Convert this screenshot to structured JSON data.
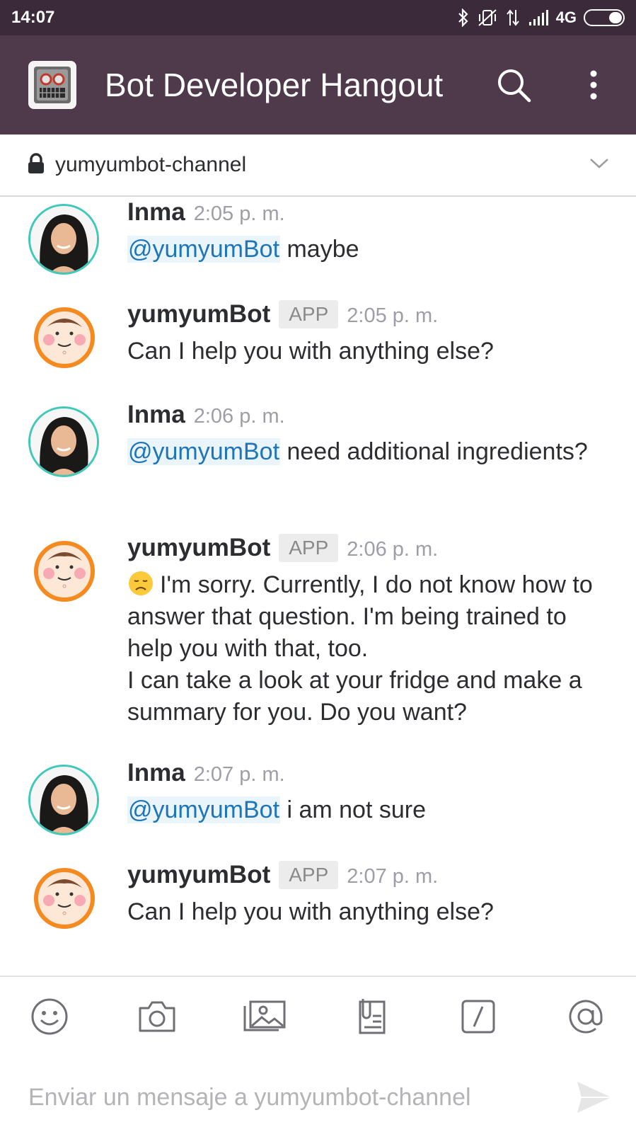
{
  "status_bar": {
    "time": "14:07",
    "network": "4G",
    "icons": [
      "bluetooth-icon",
      "vibrate-off-icon",
      "data-arrows-icon",
      "signal-icon",
      "battery-icon"
    ]
  },
  "header": {
    "team_name": "Bot Developer Hangout",
    "team_icon": "robot-icon",
    "background": "#4f3a4c"
  },
  "channel": {
    "name": "yumyumbot-channel",
    "icon": "lock-icon"
  },
  "messages": [
    {
      "author": "Inma",
      "time": "2:05 p. m.",
      "mention": "@yumyumBot",
      "text": " maybe"
    },
    {
      "author": "yumyumBot",
      "badge": "APP",
      "time": "2:05 p. m.",
      "text": "Can I help you with anything else?"
    },
    {
      "author": "Inma",
      "time": "2:06 p. m.",
      "mention": "@yumyumBot",
      "text": " need additional ingredients?"
    },
    {
      "author": "yumyumBot",
      "badge": "APP",
      "time": "2:06 p. m.",
      "emoji": "disappointed-face-icon",
      "line1": "I'm sorry. Currently, I do not know how to answer that question. I'm being trained to help you with that, too.",
      "line2": "I can take a look at your fridge and make a summary for you. Do you want?"
    },
    {
      "author": "Inma",
      "time": "2:07 p. m.",
      "mention": "@yumyumBot",
      "text": " i am not sure"
    },
    {
      "author": "yumyumBot",
      "badge": "APP",
      "time": "2:07 p. m.",
      "text": "Can I help you with anything else?"
    }
  ],
  "composer": {
    "placeholder": "Enviar un mensaje a yumyumbot-channel",
    "value": "",
    "tools": [
      "emoji-icon",
      "camera-icon",
      "image-icon",
      "file-icon",
      "slash-command-icon",
      "at-mention-icon"
    ],
    "send_icon": "send-icon"
  },
  "colors": {
    "status_bar": "#3b2a3a",
    "mention": "#1f75b8",
    "user_avatar_ring": "#3fc9b9",
    "bot_avatar_ring": "#f58a20"
  }
}
